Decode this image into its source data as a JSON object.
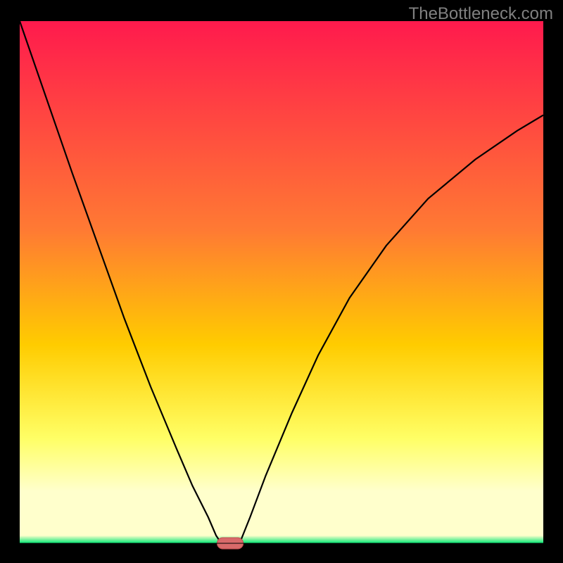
{
  "watermark": "TheBottleneck.com",
  "colors": {
    "black": "#000000",
    "grad_top": "#ff1a4d",
    "grad_mid_top": "#ff7a33",
    "grad_mid": "#ffcc00",
    "grad_low": "#ffff66",
    "grad_pale": "#ffffcc",
    "grad_base": "#00e673",
    "marker_fill": "#d96a6a",
    "marker_stroke": "#bf4d4d"
  },
  "chart_data": {
    "type": "line",
    "title": "",
    "xlabel": "",
    "ylabel": "",
    "xlim": [
      0,
      1
    ],
    "ylim": [
      0,
      1
    ],
    "series": [
      {
        "name": "left-curve",
        "x": [
          0.0,
          0.05,
          0.1,
          0.15,
          0.2,
          0.25,
          0.3,
          0.33,
          0.36,
          0.375,
          0.385
        ],
        "y": [
          1.0,
          0.855,
          0.71,
          0.57,
          0.43,
          0.3,
          0.18,
          0.11,
          0.05,
          0.015,
          0.0
        ]
      },
      {
        "name": "right-curve",
        "x": [
          0.42,
          0.44,
          0.47,
          0.52,
          0.57,
          0.63,
          0.7,
          0.78,
          0.87,
          0.95,
          1.0
        ],
        "y": [
          0.0,
          0.05,
          0.13,
          0.25,
          0.36,
          0.47,
          0.57,
          0.66,
          0.735,
          0.79,
          0.82
        ]
      }
    ],
    "marker": {
      "x": 0.402,
      "y": 0.0,
      "width_frac": 0.05
    },
    "gradient_stops": [
      {
        "offset": 0.0,
        "color_key": "grad_top"
      },
      {
        "offset": 0.4,
        "color_key": "grad_mid_top"
      },
      {
        "offset": 0.62,
        "color_key": "grad_mid"
      },
      {
        "offset": 0.8,
        "color_key": "grad_low"
      },
      {
        "offset": 0.9,
        "color_key": "grad_pale"
      },
      {
        "offset": 0.985,
        "color_key": "grad_pale"
      },
      {
        "offset": 1.0,
        "color_key": "grad_base"
      }
    ]
  }
}
